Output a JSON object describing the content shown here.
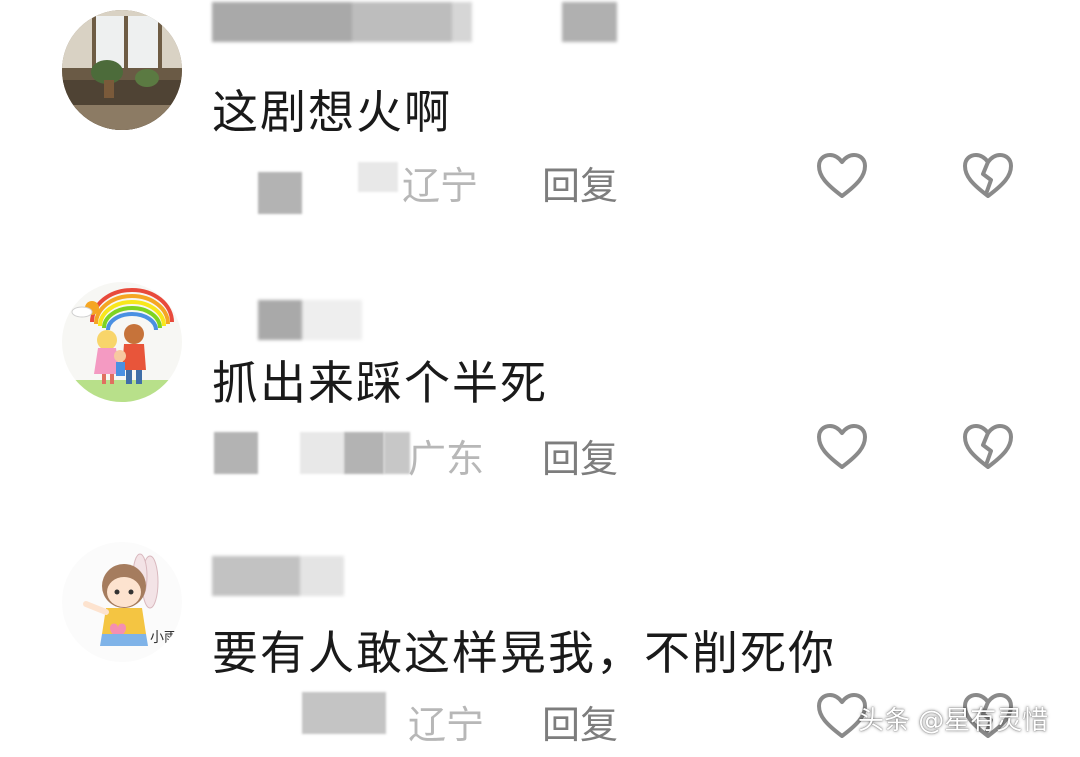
{
  "comments": [
    {
      "text": "这剧想火啊",
      "location": "辽宁",
      "reply_label": "回复",
      "avatar": "window-plant-photo"
    },
    {
      "text": "抓出来踩个半死",
      "location": "广东",
      "reply_label": "回复",
      "avatar": "rainbow-family-cartoon"
    },
    {
      "text": "要有人敢这样晃我，不削死你",
      "location": "辽宁",
      "reply_label": "回复",
      "avatar": "girl-bunny-ears-cartoon",
      "avatar_caption": "小雨"
    }
  ],
  "icons": {
    "like": "heart-outline-icon",
    "dislike": "broken-heart-icon"
  },
  "colors": {
    "text": "#1a1a1a",
    "reply": "#7d7d7d",
    "location": "#b7b7b7",
    "icon": "#8a8a8a"
  },
  "watermark": "头条 @星有灵惜"
}
